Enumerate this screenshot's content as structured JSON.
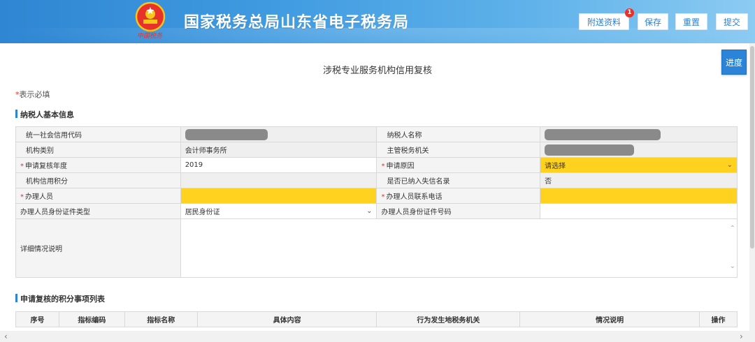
{
  "header": {
    "site_title": "国家税务总局山东省电子税务局",
    "emblem_caption": "中国税务",
    "toolbar": {
      "attachments_label": "附送资料",
      "attachments_badge": "1",
      "save_label": "保存",
      "reset_label": "重置",
      "submit_label": "提交"
    }
  },
  "progress_label": "进度",
  "page_heading": "涉税专业服务机构信用复核",
  "required_note": {
    "star": "*",
    "text": "表示必填"
  },
  "sections": {
    "taxpayer_info": "纳税人基本信息",
    "score_items": "申请复核的积分事项列表"
  },
  "form": {
    "credit_code_label": "统一社会信用代码",
    "taxpayer_name_label": "纳税人名称",
    "org_type_label": "机构类别",
    "org_type_value": "会计师事务所",
    "tax_authority_label": "主管税务机关",
    "review_year_label": "申请复核年度",
    "review_year_value": "2019",
    "reason_label": "申请原因",
    "reason_value": "请选择",
    "credit_score_label": "机构信用积分",
    "dishonest_list_label": "是否已纳入失信名录",
    "dishonest_list_value": "否",
    "handler_label": "办理人员",
    "handler_phone_label": "办理人员联系电话",
    "id_type_label": "办理人员身份证件类型",
    "id_type_value": "居民身份证",
    "id_number_label": "办理人员身份证件号码",
    "details_label": "详细情况说明"
  },
  "list_table": {
    "headers": [
      "序号",
      "指标编码",
      "指标名称",
      "具体内容",
      "行为发生地税务机关",
      "情况说明",
      "操作"
    ]
  },
  "colors": {
    "accent": "#2c84d8",
    "required": "#e6322b",
    "highlight_field": "#ffd21f"
  }
}
